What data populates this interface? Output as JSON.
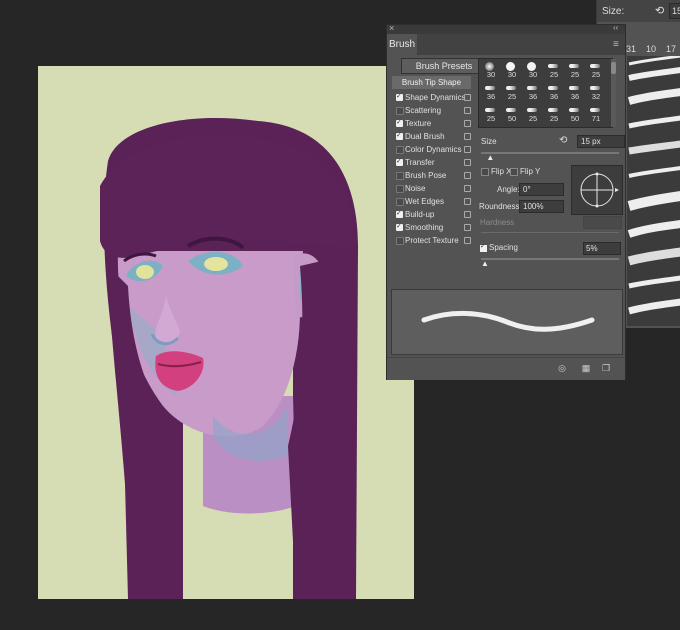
{
  "colors": {
    "app_bg": "#262626",
    "canvas_bg": "#d6dcb4",
    "panel_bg": "#535353",
    "hair": "#5c2358",
    "skin": "#c79bc7"
  },
  "brush_presets_panel": {
    "size_label": "Size:",
    "size_value": "15",
    "reset_icon": "reset-icon",
    "numbers": [
      "31",
      "10",
      "17"
    ]
  },
  "brush_panel": {
    "close_icon": "close-icon",
    "collapse_icon": "double-chevron-icon",
    "tab": "Brush",
    "menu_icon": "panel-menu-icon",
    "presets_button": "Brush Presets",
    "tip_shape": "Brush Tip Shape",
    "options": [
      {
        "label": "Shape Dynamics",
        "checked": true
      },
      {
        "label": "Scattering",
        "checked": false
      },
      {
        "label": "Texture",
        "checked": true
      },
      {
        "label": "Dual Brush",
        "checked": true
      },
      {
        "label": "Color Dynamics",
        "checked": false
      },
      {
        "label": "Transfer",
        "checked": true
      },
      {
        "label": "Brush Pose",
        "checked": false
      },
      {
        "label": "Noise",
        "checked": false
      },
      {
        "label": "Wet Edges",
        "checked": false
      },
      {
        "label": "Build-up",
        "checked": true
      },
      {
        "label": "Smoothing",
        "checked": true
      },
      {
        "label": "Protect Texture",
        "checked": false
      }
    ],
    "tip_sizes": [
      [
        "30",
        "30",
        "30",
        "25",
        "25",
        "25"
      ],
      [
        "36",
        "25",
        "36",
        "36",
        "36",
        "32"
      ],
      [
        "25",
        "50",
        "25",
        "25",
        "50",
        "71"
      ]
    ],
    "size_label": "Size",
    "size_value": "15 px",
    "flip_x": "Flip X",
    "flip_y": "Flip Y",
    "angle_label": "Angle:",
    "angle_value": "0°",
    "roundness_label": "Roundness:",
    "roundness_value": "100%",
    "hardness_label": "Hardness",
    "spacing_label": "Spacing",
    "spacing_value": "5%",
    "size_slider_fraction": 0.04,
    "spacing_slider_fraction": 0.0
  }
}
